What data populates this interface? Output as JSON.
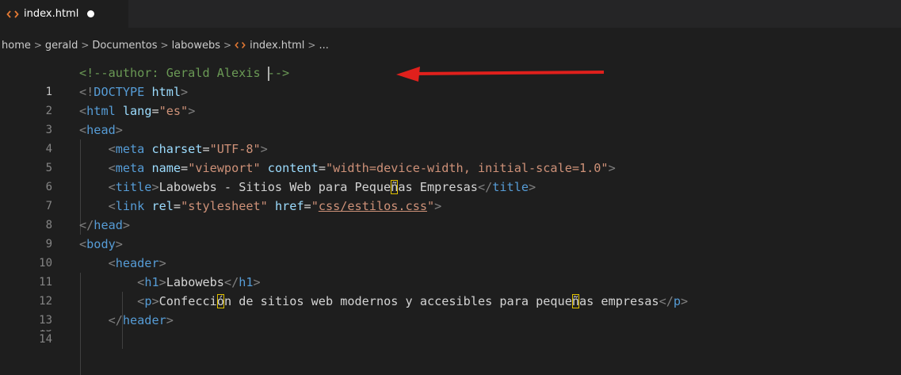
{
  "tab": {
    "label": "index.html",
    "icon": "html-file-icon",
    "dirty": true
  },
  "breadcrumb": {
    "items": [
      "home",
      "gerald",
      "Documentos",
      "labowebs",
      "index.html",
      "..."
    ],
    "separator": ">"
  },
  "editor": {
    "line_numbers": [
      "1",
      "2",
      "3",
      "4",
      "5",
      "6",
      "7",
      "8",
      "9",
      "10",
      "11",
      "12",
      "13",
      "14"
    ],
    "current_line": "1",
    "lines": [
      "<!--author: Gerald Alexis -->",
      "<!DOCTYPE html>",
      "<html lang=\"es\">",
      "<head>",
      "<meta charset=\"UTF-8\">",
      "<meta name=\"viewport\" content=\"width=device-width, initial-scale=1.0\">",
      "<title>Labowebs - Sitios Web para Pequeñas Empresas</title>",
      "<link rel=\"stylesheet\" href=\"css/estilos.css\">",
      "</head>",
      "<body>",
      "<header>",
      "<h1>Labowebs</h1>",
      "<p>Confección de sitios web modernos y accesibles para pequeñas empresas</p>",
      "</header>"
    ]
  },
  "colors": {
    "background": "#1e1e1e",
    "comment": "#6a9955",
    "tag": "#569cd6",
    "attribute": "#9cdcfe",
    "string": "#ce9178",
    "arrow": "#e0201c"
  }
}
